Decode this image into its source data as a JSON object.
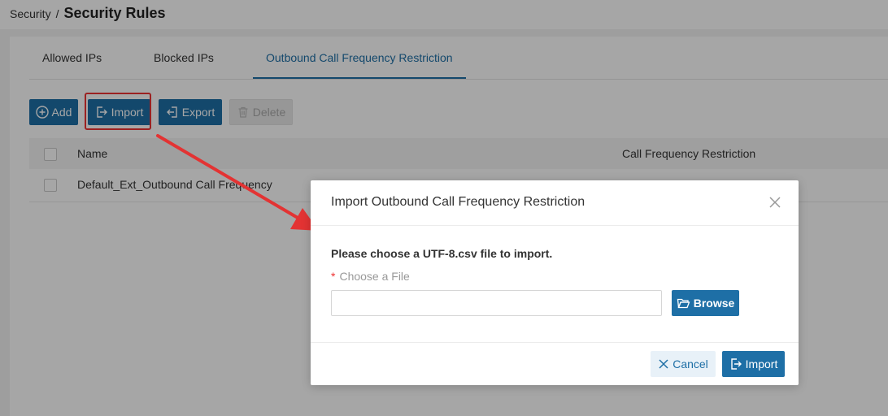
{
  "breadcrumb": {
    "parent": "Security",
    "separator": "/",
    "title": "Security Rules"
  },
  "tabs": [
    {
      "label": "Allowed IPs",
      "active": false
    },
    {
      "label": "Blocked IPs",
      "active": false
    },
    {
      "label": "Outbound Call Frequency Restriction",
      "active": true
    }
  ],
  "toolbar": {
    "add_label": "Add",
    "import_label": "Import",
    "export_label": "Export",
    "delete_label": "Delete"
  },
  "table": {
    "columns": [
      "Name",
      "Call Frequency Restriction"
    ],
    "rows": [
      {
        "name": "Default_Ext_Outbound Call Frequency"
      }
    ]
  },
  "modal": {
    "title": "Import Outbound Call Frequency Restriction",
    "prompt": "Please choose a UTF-8.csv file to import.",
    "required_mark": "*",
    "file_label": "Choose a File",
    "file_value": "",
    "browse_label": "Browse",
    "cancel_label": "Cancel",
    "import_label": "Import"
  },
  "colors": {
    "primary": "#1e6fa6",
    "annotation": "#e33333",
    "overlay": "rgba(0,0,0,0.35)"
  }
}
